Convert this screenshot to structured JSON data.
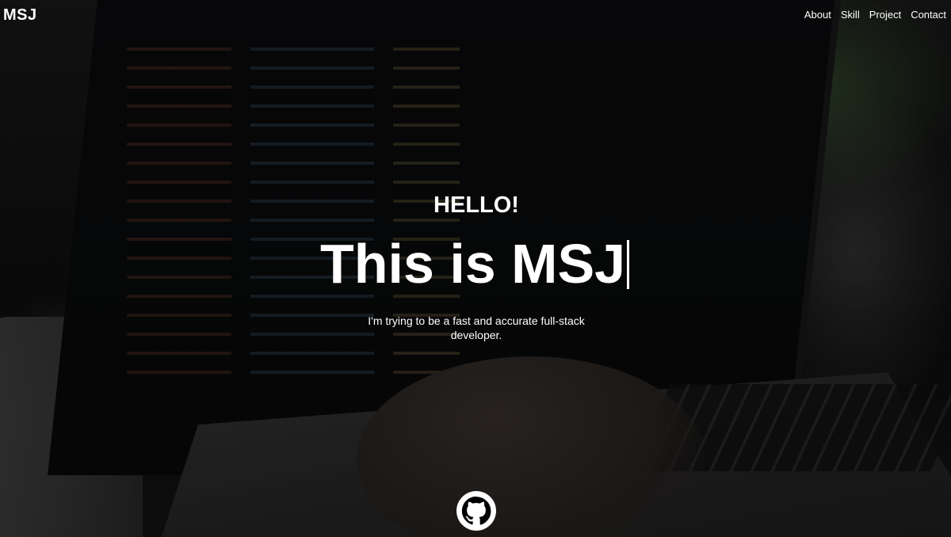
{
  "brand": {
    "logo_text": "MSJ"
  },
  "nav": {
    "items": [
      {
        "label": "About"
      },
      {
        "label": "Skill"
      },
      {
        "label": "Project"
      },
      {
        "label": "Contact"
      }
    ]
  },
  "hero": {
    "greeting": "HELLO!",
    "headline": "This is MSJ",
    "subtitle": "I'm trying to be a fast and accurate full-stack developer.",
    "social_icon": "github-icon"
  },
  "colors": {
    "text": "#ffffff",
    "overlay": "#000000"
  }
}
